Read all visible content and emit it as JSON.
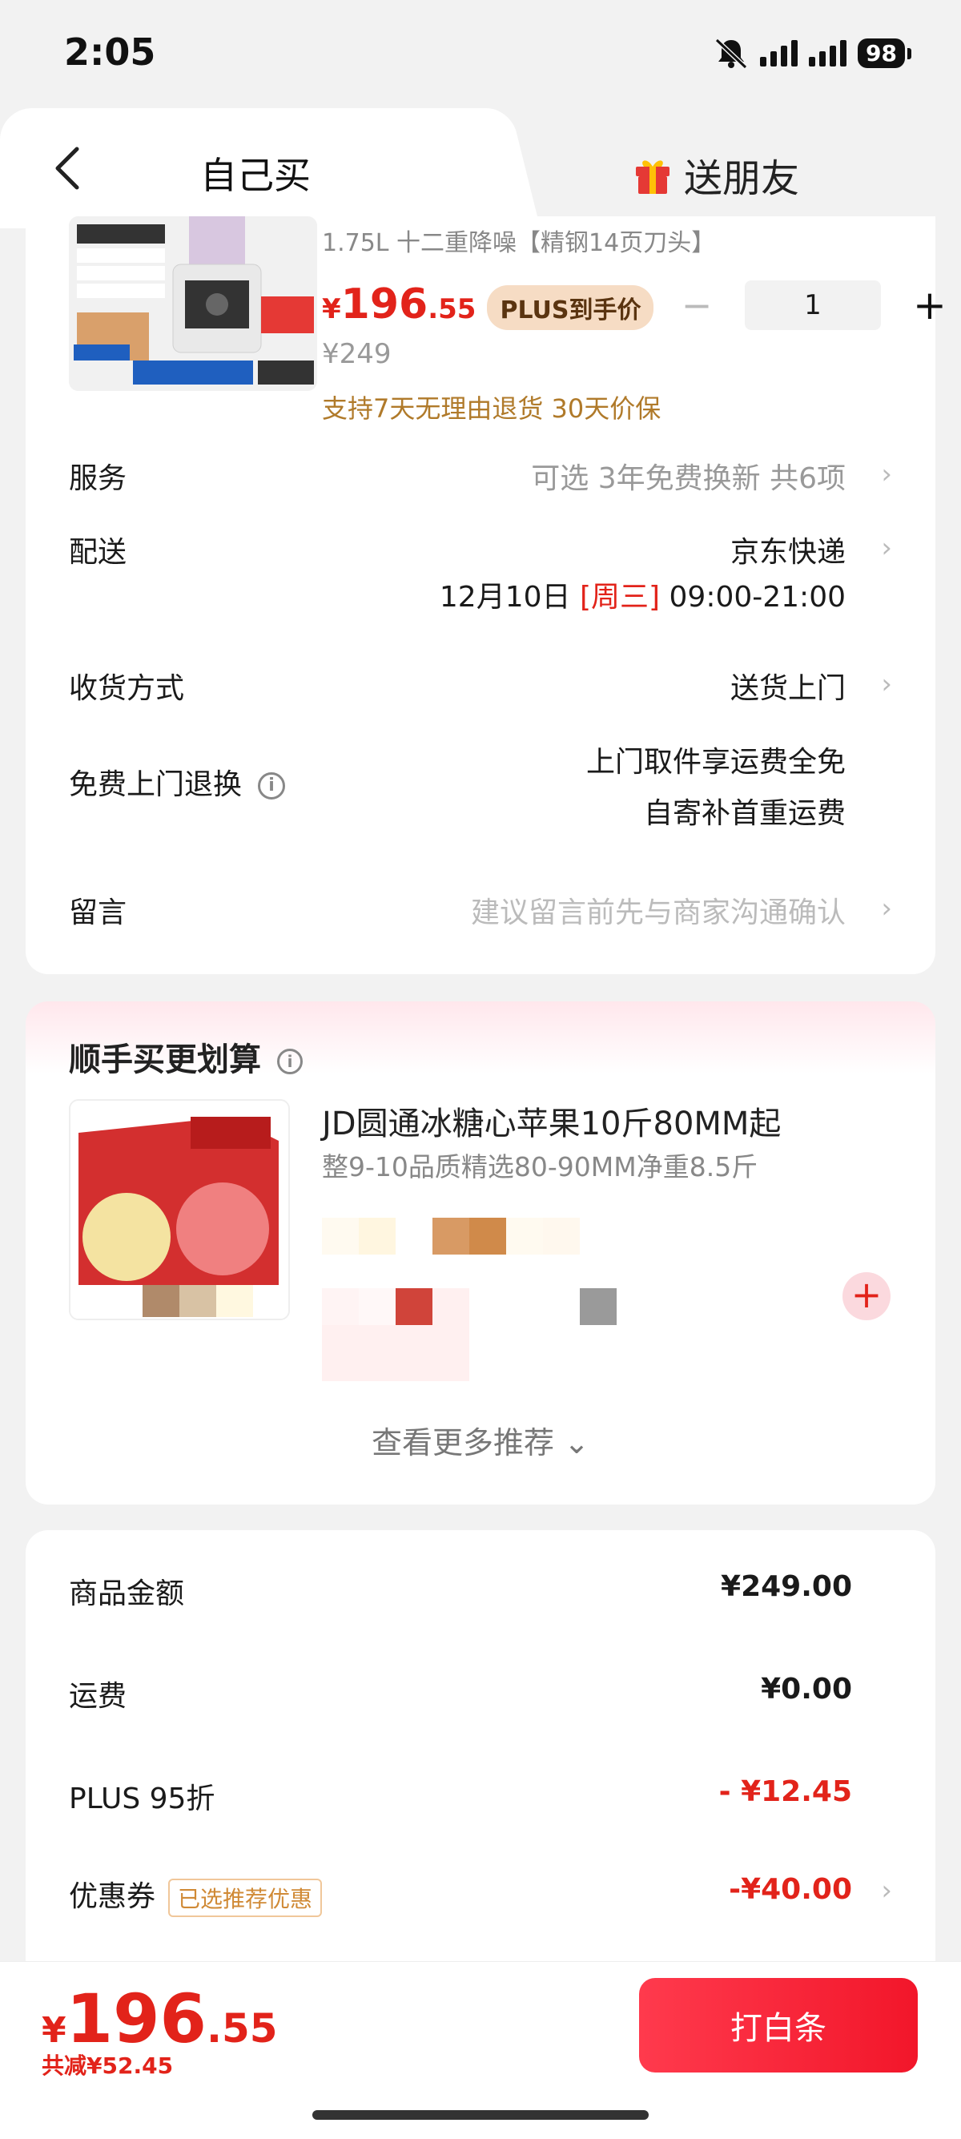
{
  "status_bar": {
    "time": "2:05",
    "battery": "98"
  },
  "tabs": {
    "self": "自己买",
    "friend": "送朋友"
  },
  "product": {
    "subtitle": "1.75L 十二重降噪【精钢14页刀头】",
    "price_yen": "¥",
    "price_int": "196",
    "price_dec": ".55",
    "plus_badge": "PLUS到手价",
    "original_price": "¥249",
    "quantity": "1",
    "guarantee": "支持7天无理由退货 30天价保"
  },
  "rows": {
    "service": {
      "label": "服务",
      "value": "可选 3年免费换新 共6项"
    },
    "delivery": {
      "label": "配送",
      "value": "京东快递",
      "date": "12月10日",
      "weekday": "[周三]",
      "time": "09:00-21:00"
    },
    "receive": {
      "label": "收货方式",
      "value": "送货上门"
    },
    "free_return": {
      "label": "免费上门退换",
      "line1": "上门取件享运费全免",
      "line2": "自寄补首重运费"
    },
    "message": {
      "label": "留言",
      "placeholder": "建议留言前先与商家沟通确认"
    }
  },
  "recommend": {
    "title": "顺手买更划算",
    "item_name": "JD圆通冰糖心苹果10斤80MM起",
    "item_desc": "整9-10品质精选80-90MM净重8.5斤",
    "more": "查看更多推荐"
  },
  "summary": {
    "goods_label": "商品金额",
    "goods_value": "¥249.00",
    "shipping_label": "运费",
    "shipping_value": "¥0.00",
    "plus_label": "PLUS 95折",
    "plus_value": "- ¥12.45",
    "coupon_label": "优惠券",
    "coupon_tag": "已选推荐优惠",
    "coupon_value": "-¥40.00"
  },
  "bottom": {
    "total_yen": "¥",
    "total_int": "196",
    "total_dec": ".55",
    "saved": "共减¥52.45",
    "pay_button": "打白条"
  },
  "colors": {
    "accent_red": "#e2231a",
    "gold": "#b07a2a"
  }
}
